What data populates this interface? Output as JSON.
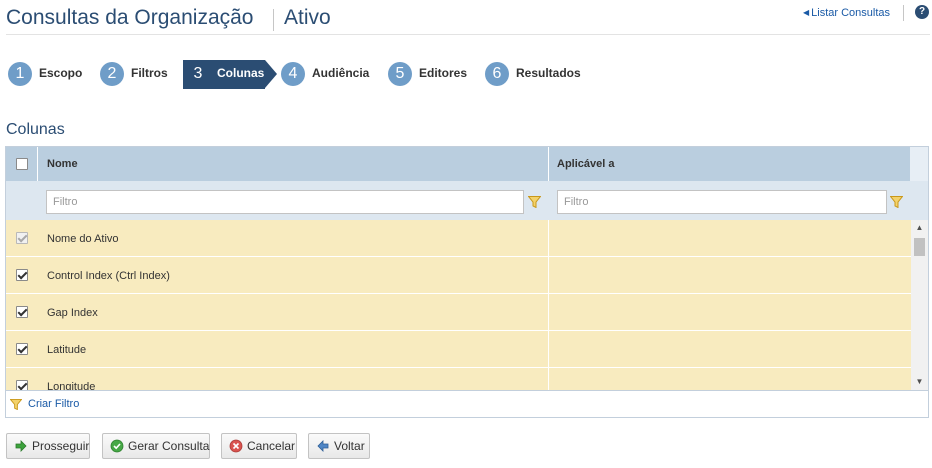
{
  "header": {
    "title": "Consultas da Organização",
    "subtitle": "Ativo",
    "list_link": "Listar Consultas",
    "help": "?"
  },
  "steps": [
    {
      "num": "1",
      "label": "Escopo"
    },
    {
      "num": "2",
      "label": "Filtros"
    },
    {
      "num": "3",
      "label": "Colunas",
      "active": true
    },
    {
      "num": "4",
      "label": "Audiência"
    },
    {
      "num": "5",
      "label": "Editores"
    },
    {
      "num": "6",
      "label": "Resultados"
    }
  ],
  "section_title": "Colunas",
  "grid": {
    "columns": [
      "Nome",
      "Aplicável a"
    ],
    "filter_placeholder_name": "Filtro",
    "filter_placeholder_applies": "Filtro",
    "rows": [
      {
        "name": "Nome do Ativo",
        "applies_to": "",
        "checked": true,
        "disabled": true
      },
      {
        "name": "Control Index (Ctrl Index)",
        "applies_to": "",
        "checked": true,
        "disabled": false
      },
      {
        "name": "Gap Index",
        "applies_to": "",
        "checked": true,
        "disabled": false
      },
      {
        "name": "Latitude",
        "applies_to": "",
        "checked": true,
        "disabled": false
      },
      {
        "name": "Longitude",
        "applies_to": "",
        "checked": true,
        "disabled": false
      }
    ],
    "create_filter": "Criar Filtro"
  },
  "buttons": {
    "proceed": "Prosseguir",
    "generate": "Gerar Consulta",
    "cancel": "Cancelar",
    "back": "Voltar"
  },
  "colors": {
    "brand": "#2b4d73",
    "step_circle": "#6f9dc8",
    "header_bg": "#bacedf",
    "filter_bg": "#dde7f0",
    "row_bg": "#f8ebbf",
    "link": "#1a5aa6",
    "funnel": "#e0b21c"
  }
}
